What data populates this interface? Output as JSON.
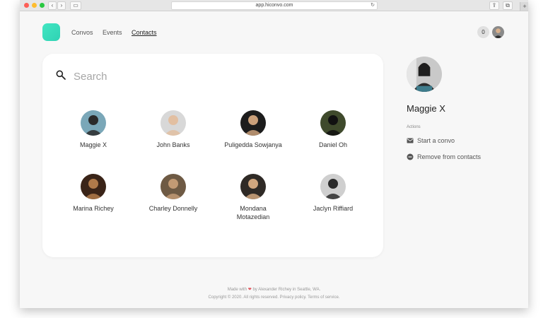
{
  "browser": {
    "url": "app.hiconvo.com",
    "plus_label": "+"
  },
  "nav": {
    "items": [
      {
        "label": "Convos",
        "active": false
      },
      {
        "label": "Events",
        "active": false
      },
      {
        "label": "Contacts",
        "active": true
      }
    ],
    "notification_count": "0"
  },
  "search": {
    "placeholder": "Search",
    "value": ""
  },
  "contacts": [
    {
      "name": "Maggie X",
      "avatar_colors": [
        "#7aa7b8",
        "#2a2a2a"
      ]
    },
    {
      "name": "John Banks",
      "avatar_colors": [
        "#d8d8d8",
        "#e2bfa1"
      ]
    },
    {
      "name": "Puligedda Sowjanya",
      "avatar_colors": [
        "#1c1c1c",
        "#caa07a"
      ]
    },
    {
      "name": "Daniel Oh",
      "avatar_colors": [
        "#3f4a2c",
        "#111111"
      ]
    },
    {
      "name": "Marina Richey",
      "avatar_colors": [
        "#3a2418",
        "#b07a4a"
      ]
    },
    {
      "name": "Charley Donnelly",
      "avatar_colors": [
        "#6e5a44",
        "#c29a74"
      ]
    },
    {
      "name": "Mondana\nMotazedian",
      "avatar_colors": [
        "#2f2a26",
        "#d0a67e"
      ]
    },
    {
      "name": "Jaclyn Riffiard",
      "avatar_colors": [
        "#cfcfcf",
        "#2a2a2a"
      ]
    }
  ],
  "profile": {
    "name": "Maggie X",
    "actions_label": "Actions",
    "actions": [
      {
        "label": "Start a convo",
        "icon": "mail-icon"
      },
      {
        "label": "Remove from contacts",
        "icon": "remove-icon"
      }
    ]
  },
  "footer": {
    "made_prefix": "Made with",
    "made_suffix": "by Alexander Richey in Seattle, WA.",
    "copyright": "Copyright © 2020. All rights reserved. Privacy policy. Terms of service."
  },
  "colors": {
    "accent": "#36dcbc",
    "heart": "#e0525a"
  }
}
